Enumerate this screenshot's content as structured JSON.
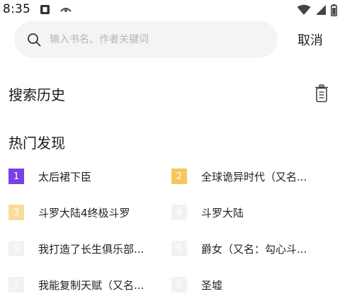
{
  "status_bar": {
    "time": "8:35",
    "icons": [
      "notification-a-icon",
      "notification-b-icon",
      "wifi-icon",
      "cellular-signal-icon",
      "battery-icon"
    ]
  },
  "search": {
    "placeholder": "输入书名、作者关键词",
    "cancel_label": "取消"
  },
  "history": {
    "title": "搜索历史",
    "clear_icon": "trash-icon"
  },
  "hot": {
    "title": "热门发现",
    "items": [
      {
        "rank": "1",
        "title": "太后裙下臣",
        "badge_color": "#7b3fe4"
      },
      {
        "rank": "2",
        "title": "全球诡异时代（又名...",
        "badge_color": "#f5c75a"
      },
      {
        "rank": "3",
        "title": "斗罗大陆4终极斗罗",
        "badge_color": "#f7dc9a"
      },
      {
        "rank": "4",
        "title": "斗罗大陆",
        "badge_color": "#f2f2f4"
      },
      {
        "rank": "5",
        "title": "我打造了长生俱乐部...",
        "badge_color": "#f2f2f4"
      },
      {
        "rank": "6",
        "title": "爵女（又名：勾心斗...",
        "badge_color": "#f2f2f4"
      },
      {
        "rank": "7",
        "title": "我能复制天赋（又名...",
        "badge_color": "#f2f2f4"
      },
      {
        "rank": "8",
        "title": "圣墟",
        "badge_color": "#f2f2f4"
      }
    ]
  }
}
